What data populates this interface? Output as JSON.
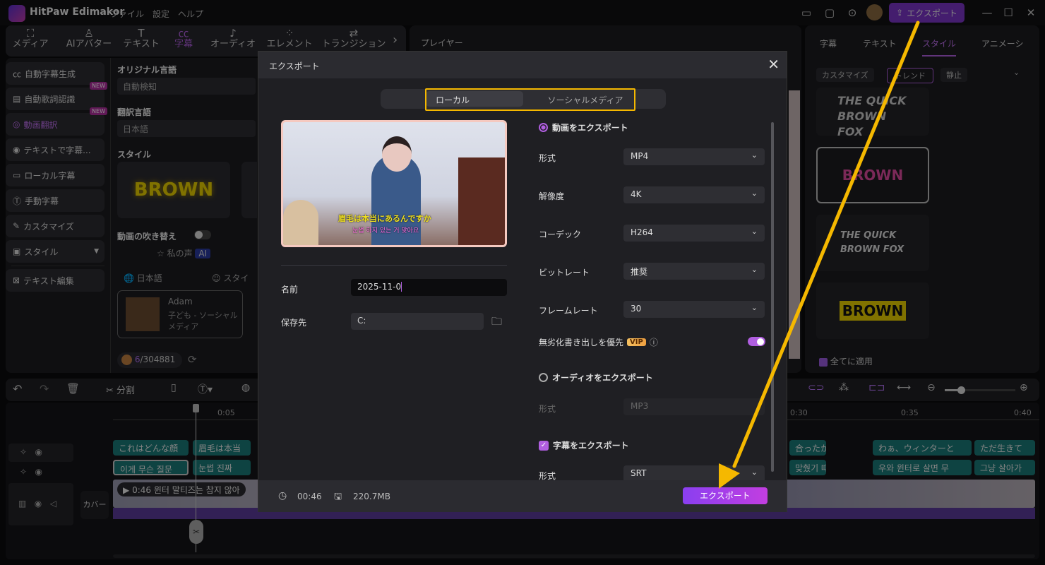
{
  "app": {
    "name": "HitPaw Edimakor",
    "menu": [
      "ファイル",
      "設定",
      "ヘルプ"
    ],
    "export_label": "エクスポート"
  },
  "toolbar": {
    "tabs": [
      "メディア",
      "AIアバター",
      "テキスト",
      "字幕",
      "オーディオ",
      "エレメント",
      "トランジション"
    ],
    "active": "字幕"
  },
  "sidebar": {
    "items": [
      {
        "label": "自動字幕生成"
      },
      {
        "label": "自動歌詞認識",
        "badge": "NEW"
      },
      {
        "label": "動画翻訳",
        "badge": "NEW"
      },
      {
        "label": "テキストで字幕..."
      },
      {
        "label": "ローカル字幕"
      },
      {
        "label": "手動字幕"
      },
      {
        "label": "カスタマイズ"
      },
      {
        "label": "スタイル"
      },
      {
        "label": "テキスト編集"
      }
    ]
  },
  "middle": {
    "original_language_label": "オリジナル言語",
    "original_language_value": "自動検知",
    "translate_language_label": "翻訳言語",
    "translate_language_value": "日本語",
    "style_label": "スタイル",
    "style_preview": "BROWN",
    "dubbing_label": "動画の吹き替え",
    "my_voice": "私の声",
    "ai_badge": "AI",
    "lang_select": "日本語",
    "style_select": "スタイ",
    "voice_name": "Adam",
    "voice_desc": "子ども - ソーシャルメディア",
    "credits_used": "6",
    "credits_total": "/304881"
  },
  "player": {
    "title": "プレイヤー"
  },
  "right_panel": {
    "tabs": [
      "字幕",
      "テキスト",
      "スタイル",
      "アニメーシ"
    ],
    "active_tab": "スタイル",
    "filters": [
      "カスタマイズ",
      "トレンド",
      "静止"
    ],
    "active_filter": "トレンド",
    "styles": [
      "THE QUICK BROWN FOX",
      "BROWN",
      "THE QUICK BROWN FOX",
      "BROWN"
    ],
    "apply_all": "全てに適用"
  },
  "timeline": {
    "split_label": "分割",
    "ticks": [
      "0:05",
      "0:30",
      "0:35",
      "0:40"
    ],
    "track1": [
      "これはどんな顔",
      "眉毛は本当",
      "合ったから",
      "わぁ、ウィンターと",
      "ただ生きて"
    ],
    "track2": [
      "이게 무슨 질문",
      "눈썹 진짜",
      "맞췄기 때",
      "우와 윈터로 살면 무",
      "그냥 살아가"
    ],
    "video_clip": "0:46 윈터 말티즈는 참지 않아",
    "cover_label": "カバー"
  },
  "dialog": {
    "title": "エクスポート",
    "tabs": {
      "local": "ローカル",
      "social": "ソーシャルメディア"
    },
    "preview_subtitle_ja": "眉毛は本当にあるんですか",
    "preview_subtitle_ko": "눈썹 하지 있는 거 맞아요",
    "name_label": "名前",
    "name_value": "2025-11-0",
    "save_label": "保存先",
    "save_value": "C:",
    "video_export": "動画をエクスポート",
    "format_label": "形式",
    "format_value": "MP4",
    "resolution_label": "解像度",
    "resolution_value": "4K",
    "codec_label": "コーデック",
    "codec_value": "H264",
    "bitrate_label": "ビットレート",
    "bitrate_value": "推奨",
    "framerate_label": "フレームレート",
    "framerate_value": "30",
    "lossless_label": "無劣化書き出しを優先",
    "vip": "VIP",
    "lossless_on": true,
    "audio_export": "オーディオをエクスポート",
    "audio_format_label": "形式",
    "audio_format_value": "MP3",
    "subtitle_export": "字幕をエクスポート",
    "subtitle_format_label": "形式",
    "subtitle_format_value": "SRT",
    "duration": "00:46",
    "size": "220.7MB",
    "export_button": "エクスポート"
  },
  "colors": {
    "accent": "#b05ee0",
    "highlight": "#f5b800"
  }
}
